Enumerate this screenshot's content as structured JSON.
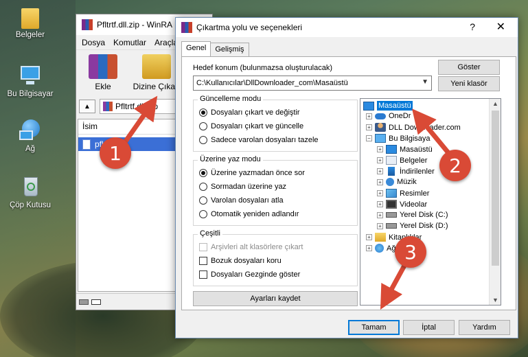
{
  "desktop": {
    "icons": [
      {
        "label": "Belgeler",
        "icon": "folder-icon"
      },
      {
        "label": "Bu Bilgisayar",
        "icon": "computer-icon"
      },
      {
        "label": "Ağ",
        "icon": "network-icon"
      },
      {
        "label": "Çöp Kutusu",
        "icon": "recycle-bin-icon"
      }
    ]
  },
  "winrar": {
    "title": "Pfltrtf.dll.zip - WinRA",
    "menu": [
      "Dosya",
      "Komutlar",
      "Araçla"
    ],
    "toolbar": {
      "add_label": "Ekle",
      "extract_label": "Dizine Çıkart"
    },
    "path": "Pfltrtf.dll.zip",
    "list_header": "İsim",
    "list_item": "pfl"
  },
  "dialog": {
    "title": "Çıkartma yolu ve seçenekleri",
    "help": "?",
    "close": "✕",
    "tabs": [
      "Genel",
      "Gelişmiş"
    ],
    "dest_label": "Hedef konum (bulunmazsa oluşturulacak)",
    "dest_value": "C:\\Kullanıcılar\\DllDownloader_com\\Masaüstü",
    "show_button": "Göster",
    "new_folder_button": "Yeni klasör",
    "update_mode": {
      "title": "Güncelleme modu",
      "options": [
        "Dosyaları çıkart ve değiştir",
        "Dosyaları çıkart ve güncelle",
        "Sadece varolan dosyaları tazele"
      ],
      "selected": 0
    },
    "overwrite_mode": {
      "title": "Üzerine yaz modu",
      "options": [
        "Üzerine yazmadan önce sor",
        "Sormadan üzerine yaz",
        "Varolan dosyaları atla",
        "Otomatik yeniden adlandır"
      ],
      "selected": 0
    },
    "misc": {
      "title": "Çeşitli",
      "options": [
        "Arşivleri alt klasörlere çıkart",
        "Bozuk dosyaları koru",
        "Dosyaları Gezginde göster"
      ],
      "disabled": [
        true,
        false,
        false
      ]
    },
    "save_button": "Ayarları kaydet",
    "tree": [
      {
        "label": "Masaüstü",
        "icon": "desktop-icon",
        "selected": true
      },
      {
        "label": "OneDr",
        "icon": "onedrive-icon",
        "expander": "+"
      },
      {
        "label": "DLL Downloader.com",
        "icon": "user-icon",
        "expander": "+"
      },
      {
        "label": "Bu Bilgisaya",
        "icon": "computer-icon",
        "expander": "−"
      },
      {
        "label": "Masaüstü",
        "icon": "desktop-icon",
        "expander": "+"
      },
      {
        "label": "Belgeler",
        "icon": "documents-icon",
        "expander": "+"
      },
      {
        "label": "İndirilenler",
        "icon": "downloads-icon",
        "expander": "+"
      },
      {
        "label": "Müzik",
        "icon": "music-icon",
        "expander": "+"
      },
      {
        "label": "Resimler",
        "icon": "pictures-icon",
        "expander": "+"
      },
      {
        "label": "Videolar",
        "icon": "videos-icon",
        "expander": "+"
      },
      {
        "label": "Yerel Disk (C:)",
        "icon": "disk-icon",
        "expander": "+"
      },
      {
        "label": "Yerel Disk (D:)",
        "icon": "disk-icon",
        "expander": "+"
      },
      {
        "label": "Kitaplıklar",
        "icon": "libraries-icon",
        "expander": "+"
      },
      {
        "label": "Ağ",
        "icon": "network-icon",
        "expander": "+"
      }
    ],
    "ok_button": "Tamam",
    "cancel_button": "İptal",
    "help_button": "Yardım"
  },
  "annotations": [
    "1",
    "2",
    "3"
  ],
  "colors": {
    "badge": "#d94a36",
    "selection": "#0078d7",
    "accent_arrow": "#d94a36"
  }
}
